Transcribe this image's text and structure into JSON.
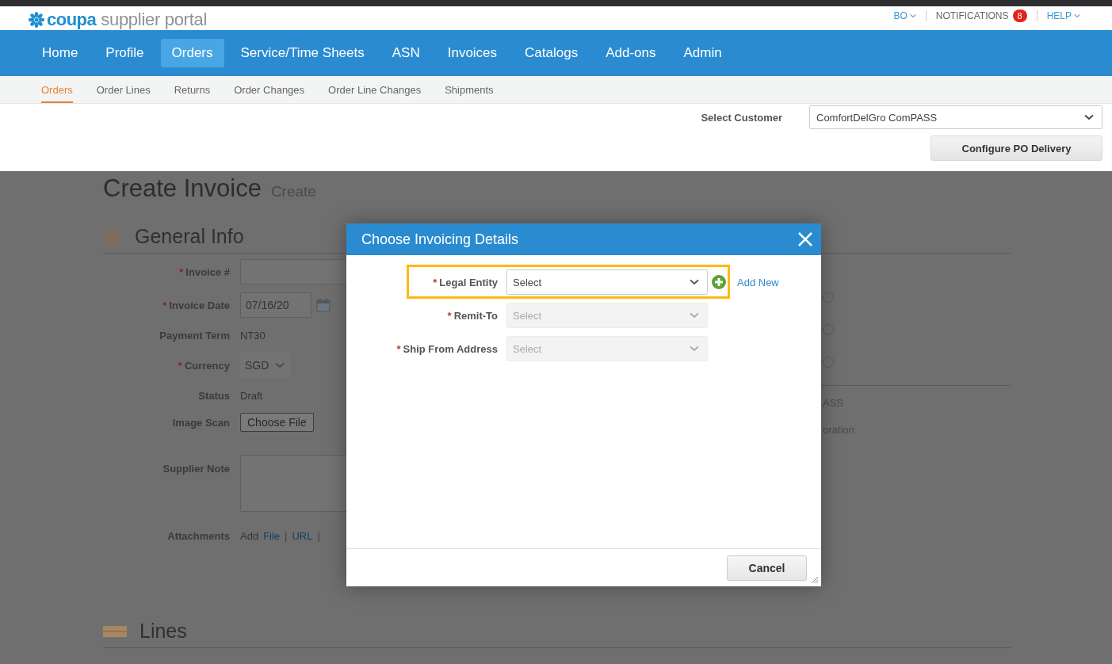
{
  "header": {
    "logo_brand": "coupa",
    "logo_product": "supplier portal",
    "user_menu": "BO",
    "notifications": {
      "label": "NOTIFICATIONS",
      "count": "8"
    },
    "help": "HELP"
  },
  "nav": [
    {
      "label": "Home",
      "selected": false
    },
    {
      "label": "Profile",
      "selected": false
    },
    {
      "label": "Orders",
      "selected": true
    },
    {
      "label": "Service/Time Sheets",
      "selected": false
    },
    {
      "label": "ASN",
      "selected": false
    },
    {
      "label": "Invoices",
      "selected": false
    },
    {
      "label": "Catalogs",
      "selected": false
    },
    {
      "label": "Add-ons",
      "selected": false
    },
    {
      "label": "Admin",
      "selected": false
    }
  ],
  "subnav": [
    {
      "label": "Orders",
      "selected": true
    },
    {
      "label": "Order Lines",
      "selected": false
    },
    {
      "label": "Returns",
      "selected": false
    },
    {
      "label": "Order Changes",
      "selected": false
    },
    {
      "label": "Order Line Changes",
      "selected": false
    },
    {
      "label": "Shipments",
      "selected": false
    }
  ],
  "customer_select": {
    "label": "Select Customer",
    "value": "ComfortDelGro ComPASS"
  },
  "configure_button": "Configure PO Delivery",
  "page": {
    "title": "Create Invoice",
    "subtitle": "Create"
  },
  "general_info": {
    "heading": "General Info",
    "fields": [
      {
        "kind": "input",
        "label": "Invoice #",
        "marker": "*"
      },
      {
        "kind": "date",
        "label": "Invoice Date",
        "marker": "*",
        "value": "07/16/20"
      },
      {
        "kind": "text",
        "label": "Payment Term",
        "value": "NT30"
      },
      {
        "kind": "select",
        "label": "Currency",
        "marker": "*",
        "value": "SGD"
      },
      {
        "kind": "text",
        "label": "Status",
        "value": "Draft"
      },
      {
        "kind": "file",
        "label": "Image Scan",
        "value": "Choose File"
      },
      {
        "kind": "textarea",
        "label": "Supplier Note"
      },
      {
        "kind": "links",
        "label": "Attachments",
        "value": "Add",
        "links": [
          "File",
          "URL"
        ],
        "separator": "|"
      }
    ],
    "side_radios": [
      {
        "selected": false
      },
      {
        "selected": false
      },
      {
        "selected": false
      }
    ],
    "side_texts": [
      "ASS",
      "oration"
    ]
  },
  "lines_heading": "Lines",
  "dialog": {
    "title": "Choose Invoicing Details",
    "fields": [
      {
        "label": "Legal Entity",
        "marker": "*",
        "placeholder": "Select",
        "disabled": false,
        "highlighted": true,
        "add_new": "Add New"
      },
      {
        "label": "Remit-To",
        "marker": "*",
        "placeholder": "Select",
        "disabled": true,
        "highlighted": false
      },
      {
        "label": "Ship From Address",
        "marker": "*",
        "placeholder": "Select",
        "disabled": true,
        "highlighted": false
      }
    ],
    "cancel": "Cancel"
  }
}
